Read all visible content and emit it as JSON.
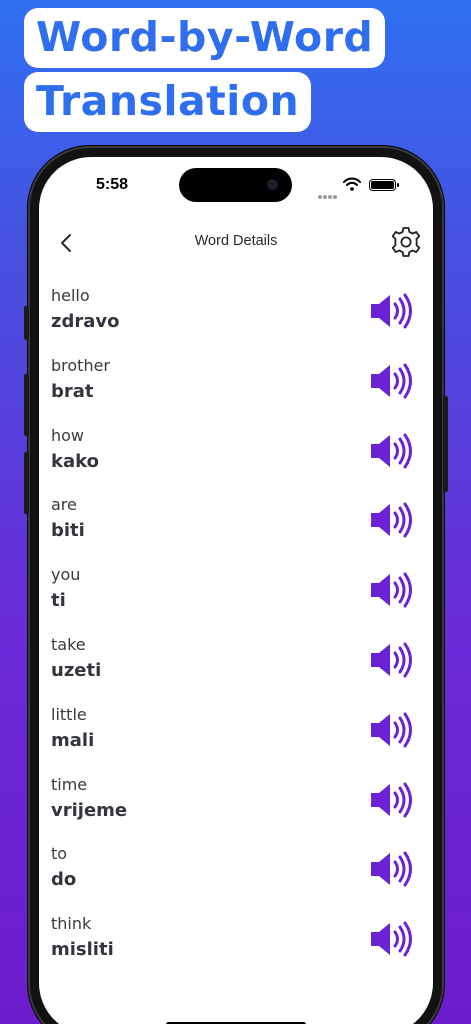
{
  "headline": {
    "line1": "Word-by-Word",
    "line2": "Translation"
  },
  "status_bar": {
    "time": "5:58"
  },
  "nav": {
    "title": "Word Details"
  },
  "colors": {
    "accent": "#6b22d6",
    "headline_text": "#2f6fef"
  },
  "words": [
    {
      "source": "hello",
      "translation": "zdravo"
    },
    {
      "source": "brother",
      "translation": "brat"
    },
    {
      "source": "how",
      "translation": "kako"
    },
    {
      "source": "are",
      "translation": "biti"
    },
    {
      "source": "you",
      "translation": "ti"
    },
    {
      "source": "take",
      "translation": "uzeti"
    },
    {
      "source": "little",
      "translation": "mali"
    },
    {
      "source": "time",
      "translation": "vrijeme"
    },
    {
      "source": "to",
      "translation": "do"
    },
    {
      "source": "think",
      "translation": "misliti"
    }
  ]
}
